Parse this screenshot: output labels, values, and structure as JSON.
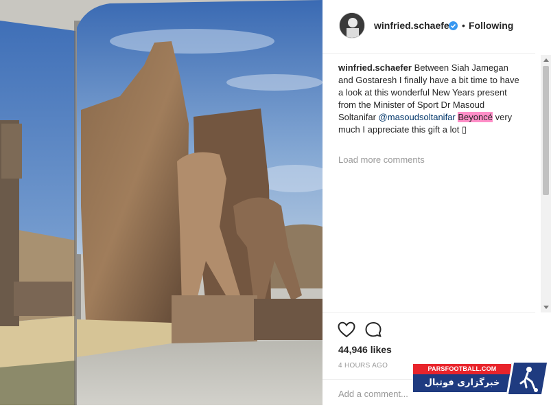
{
  "post": {
    "username": "winfried.schaefer",
    "separator": "•",
    "follow_status": "Following",
    "caption_user": "winfried.schaefer",
    "caption_part1": "Between Siah Jamegan and Gostaresh I finally have a bit time to have a look at this wonderful New Years present from the Minister of Sport Dr Masoud Soltanifar",
    "mention": "@masoudsoltanifar",
    "highlighted_word": "Beyoncé",
    "caption_part2": "very much I appreciate this gift a lot ▯",
    "load_more": "Load more comments",
    "likes": "44,946 likes",
    "time_ago": "4 HOURS AGO",
    "add_comment_placeholder": "Add a comment..."
  },
  "watermark": {
    "site": "PARSFOOTBALL.COM",
    "tagline": "خبرگزاری فوتبال ایران"
  },
  "icons": {
    "verified": "verified-badge-icon",
    "like": "heart-icon",
    "comment": "speech-bubble-icon"
  },
  "colors": {
    "verified_blue": "#3897f0",
    "mention_blue": "#003569",
    "highlight_pink": "#ff8fc8",
    "watermark_red": "#e8242b",
    "watermark_blue": "#1f3b80"
  }
}
